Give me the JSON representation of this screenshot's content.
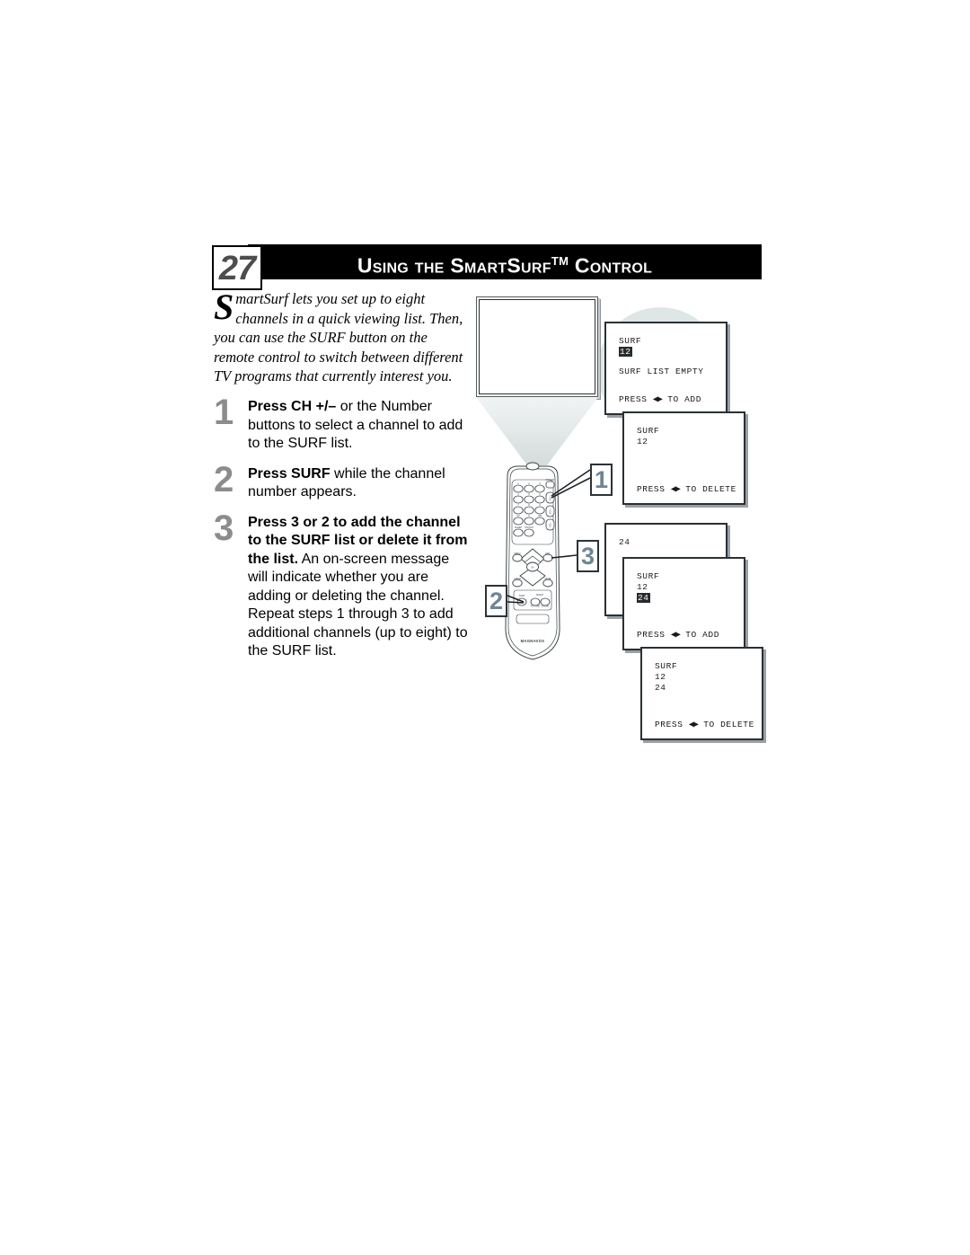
{
  "page": {
    "number": "27",
    "header_title_pre": "Using the Smart",
    "header_title_mid": "Surf",
    "header_title_tm": "TM",
    "header_title_post": "Control",
    "header_title_full": "USING THE SMARTSURF™ CONTROL"
  },
  "intro": {
    "dropcap": "S",
    "text": "martSurf lets you set up to eight channels in a quick viewing list. Then, you can use the SURF button on the remote control to switch between different TV programs that currently interest you."
  },
  "steps": [
    {
      "number": "1",
      "bold": "Press CH +/–",
      "rest": " or the Number buttons to select a channel to add to the SURF list."
    },
    {
      "number": "2",
      "bold": "Press SURF",
      "rest": " while the channel number appears."
    },
    {
      "number": "3",
      "bold": "Press 3 or 2 to add the channel to the SURF list or delete it from the list.",
      "rest": " An on-screen message will indicate whether you are adding or deleting the channel. Repeat steps 1 through 3 to add additional channels (up to eight) to the SURF list."
    }
  ],
  "illustration": {
    "remote_brand": "MAGNAVOX",
    "callouts": [
      {
        "label": "1",
        "target": "number-buttons"
      },
      {
        "label": "2",
        "target": "surf-button"
      },
      {
        "label": "3",
        "target": "left-right-arrows"
      }
    ],
    "osd_screens": [
      {
        "id": "surf-list-empty",
        "title": "SURF",
        "channels": [
          {
            "value": "12",
            "highlighted": true
          }
        ],
        "message": "SURF LIST EMPTY",
        "prompt_pre": "PRESS",
        "prompt_arrows": "◀▶",
        "prompt_post": "TO ADD"
      },
      {
        "id": "surf-12-delete",
        "title": "SURF",
        "channels": [
          {
            "value": "12",
            "highlighted": false
          }
        ],
        "message": "",
        "prompt_pre": "PRESS",
        "prompt_arrows": "◀▶",
        "prompt_post": "TO DELETE"
      },
      {
        "id": "channel-24-only",
        "title": "",
        "channels": [
          {
            "value": "24",
            "highlighted": false
          }
        ],
        "message": "",
        "prompt_pre": "",
        "prompt_arrows": "",
        "prompt_post": ""
      },
      {
        "id": "surf-12-24-add",
        "title": "SURF",
        "channels": [
          {
            "value": "12",
            "highlighted": false
          },
          {
            "value": "24",
            "highlighted": true
          }
        ],
        "message": "",
        "prompt_pre": "PRESS",
        "prompt_arrows": "◀▶",
        "prompt_post": "TO ADD"
      },
      {
        "id": "surf-12-24-delete",
        "title": "SURF",
        "channels": [
          {
            "value": "12",
            "highlighted": false
          },
          {
            "value": "24",
            "highlighted": false
          }
        ],
        "message": "",
        "prompt_pre": "PRESS",
        "prompt_arrows": "◀▶",
        "prompt_post": "TO DELETE"
      }
    ]
  },
  "colors": {
    "header_bar": "#000000",
    "page_number": "#4d4d4d",
    "step_number": "#8c8c8c",
    "callout_number": "#6e8593",
    "halo": "#dfe6e6",
    "osd_highlight": "#262b2e"
  }
}
